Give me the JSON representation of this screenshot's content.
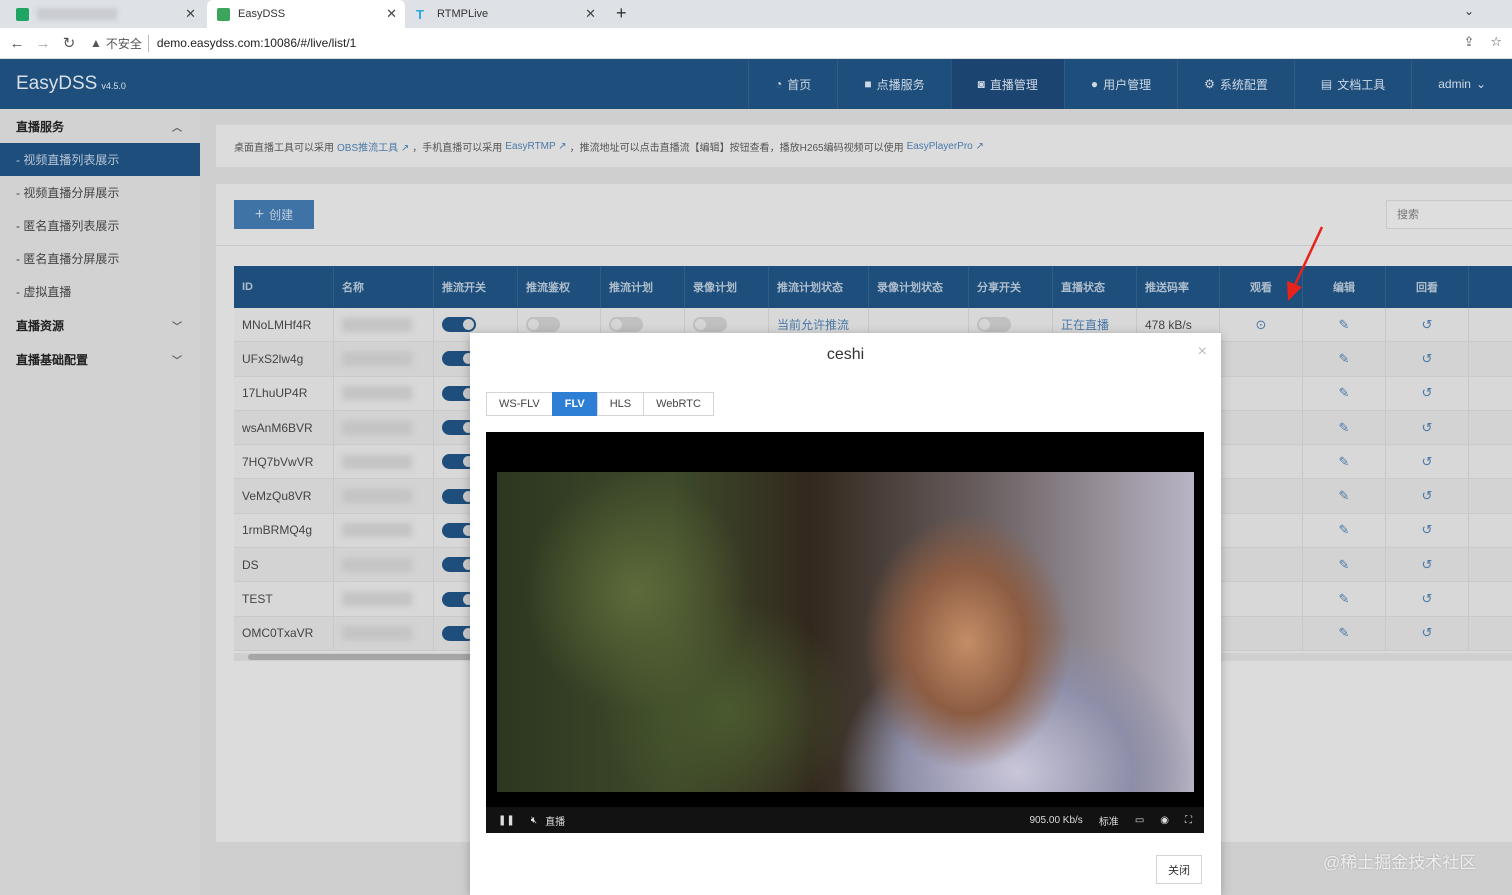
{
  "browser": {
    "tabs": [
      {
        "title": "",
        "active": false
      },
      {
        "title": "EasyDSS",
        "active": true
      },
      {
        "title": "RTMPLive",
        "active": false
      }
    ],
    "insecure_label": "不安全",
    "url": "demo.easydss.com:10086/#/live/list/1"
  },
  "header": {
    "brand": "EasyDSS",
    "version": "v4.5.0",
    "nav": [
      "首页",
      "点播服务",
      "直播管理",
      "用户管理",
      "系统配置",
      "文档工具",
      "admin"
    ]
  },
  "sidebar": {
    "groups": [
      {
        "label": "直播服务",
        "items": [
          "- 视频直播列表展示",
          "- 视频直播分屏展示",
          "- 匿名直播列表展示",
          "- 匿名直播分屏展示",
          "- 虚拟直播"
        ]
      },
      {
        "label": "直播资源",
        "items": []
      },
      {
        "label": "直播基础配置",
        "items": []
      }
    ]
  },
  "notice": {
    "t1": "桌面直播工具可以采用",
    "l1": "OBS推流工具",
    "t2": "，手机直播可以采用",
    "l2": "EasyRTMP",
    "t3": "，推流地址可以点击直播流【编辑】按钮查看，播放H265编码视频可以使用",
    "l3": "EasyPlayerPro"
  },
  "toolbar": {
    "create_label": "创建",
    "search_placeholder": "搜索"
  },
  "table": {
    "headers": [
      "ID",
      "名称",
      "推流开关",
      "推流鉴权",
      "推流计划",
      "录像计划",
      "推流计划状态",
      "录像计划状态",
      "分享开关",
      "直播状态",
      "推送码率",
      "观看",
      "编辑",
      "回看"
    ],
    "row_ids": [
      "MNoLMHf4R",
      "UFxS2lw4g",
      "17LhuUP4R",
      "wsAnM6BVR",
      "7HQ7bVwVR",
      "VeMzQu8VR",
      "1rmBRMQ4g",
      "DS",
      "TEST",
      "OMC0TxaVR"
    ],
    "first_row": {
      "push_plan_status": "当前允许推流",
      "live_status": "正在直播",
      "bitrate": "478 kB/s"
    }
  },
  "modal": {
    "title": "ceshi",
    "protocols": [
      "WS-FLV",
      "FLV",
      "HLS",
      "WebRTC"
    ],
    "active_protocol": "FLV",
    "player": {
      "live_label": "直播",
      "bitrate": "905.00 Kb/s",
      "quality": "标准"
    },
    "close_label": "关闭"
  },
  "watermark": "@稀土掘金技术社区",
  "colors": {
    "header_bg": "#1e4e7c",
    "accent": "#2d7fd6",
    "arrow": "#e8231b"
  }
}
